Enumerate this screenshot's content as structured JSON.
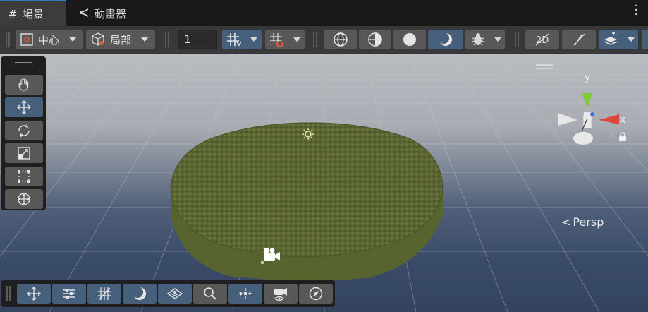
{
  "tabs": [
    {
      "label": "場景",
      "icon": "grid-hash-icon",
      "active": true
    },
    {
      "label": "動畫器",
      "icon": "animator-graph-icon",
      "active": false
    }
  ],
  "toolbar": {
    "pivot_label": "中心",
    "space_label": "局部",
    "grid_increment": "1"
  },
  "viewport": {
    "projection_label": "Persp",
    "axes": {
      "y": "y",
      "x": "x"
    }
  },
  "colors": {
    "active_button": "#46607c",
    "button": "#585858",
    "tab_accent": "#3a79bb",
    "x_axis": "#e0443a",
    "y_axis": "#7ecb3a",
    "z_axis": "#3a7be0"
  }
}
